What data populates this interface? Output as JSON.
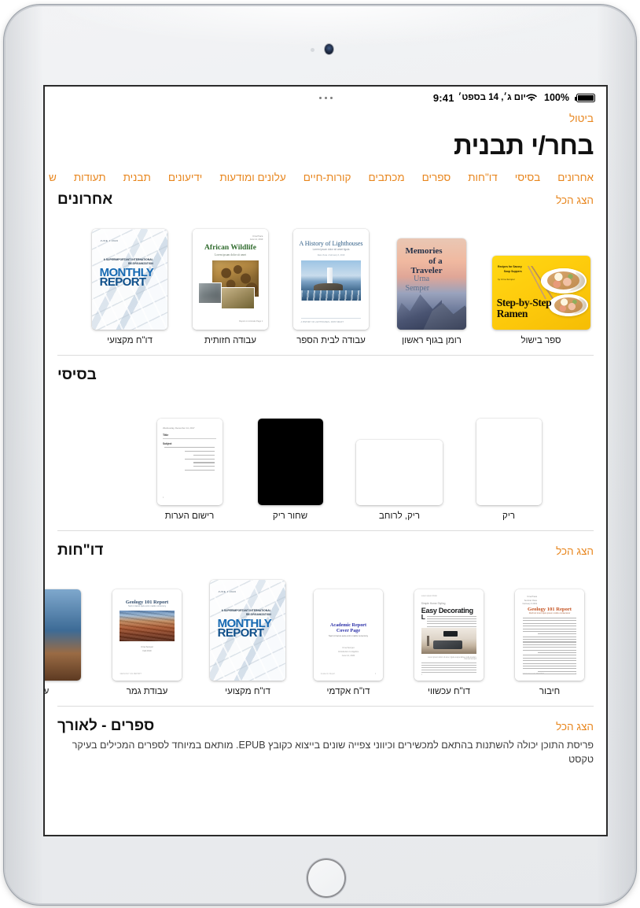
{
  "statusbar": {
    "time": "9:41",
    "date": "יום ג׳, 14 בספט׳",
    "battery_pct": "100%",
    "battery_icon": "battery-full-icon",
    "wifi_icon": "wifi-icon",
    "multitask_icon": "multitasking-dots-icon"
  },
  "topbar": {
    "cancel_label": "ביטול",
    "title": "בחר/י תבנית"
  },
  "tabs": [
    {
      "label": "אחרונים"
    },
    {
      "label": "בסיסי"
    },
    {
      "label": "דו\"חות"
    },
    {
      "label": "ספרים"
    },
    {
      "label": "מכתבים"
    },
    {
      "label": "קורות-חיים"
    },
    {
      "label": "עלונים ומודעות"
    },
    {
      "label": "ידיעונים"
    },
    {
      "label": "תבנית"
    },
    {
      "label": "תעודות"
    },
    {
      "label": "ש"
    }
  ],
  "sections": {
    "recents": {
      "title": "אחרונים",
      "show_all": "הצג הכל",
      "items": [
        {
          "label": "ספר בישול",
          "art": "ramen",
          "text": {
            "top": "Recipes for Savory\nSoup Suppers",
            "by": "by Urna Semper",
            "t1": "Step-by-Step",
            "t2": "Ramen"
          }
        },
        {
          "label": "רומן בגוף ראשון",
          "art": "memories",
          "text": {
            "title": "Memories\nof a\nTraveler",
            "author": "Urna\nSemper"
          }
        },
        {
          "label": "עבודה לבית הספר",
          "art": "lighthouse",
          "text": {
            "title": "A History of Lighthouses",
            "sub": "Lorem ipsum dolor sit amet ligula",
            "sub2": "Date Vivas  •  February 6, 2019",
            "foot": "A HISTORY OF LIGHTHOUSES  •  FIRST DRAFT"
          }
        },
        {
          "label": "עבודה חזותית",
          "art": "wildlife",
          "text": {
            "meta": "Urna Praca\nJune 14, 2019",
            "title": "African Wildlife",
            "sub": "Lorem ipsum dolor sit amet",
            "foot": "Report on Animals Page 1"
          }
        },
        {
          "label": "דו\"ח מקצועי",
          "art": "monthly",
          "text": {
            "date": "JUNE 1 2020",
            "sub": "A SUPERIMPORTANT INTERNATIONAL\nRE-ORGANIZATION",
            "t1": "MONTHLY",
            "t2": "REPORT"
          }
        }
      ]
    },
    "basic": {
      "title": "בסיסי",
      "items": [
        {
          "label": "ריק",
          "art": "blank-portrait"
        },
        {
          "label": "ריק, לרוחב",
          "art": "blank-landscape"
        },
        {
          "label": "שחור ריק",
          "art": "black-portrait"
        },
        {
          "label": "רישום הערות",
          "art": "note-taking",
          "text": {
            "head": "Wednesday, December 14, 2017",
            "title": "Title",
            "sub": "Subject",
            "page": "1"
          }
        }
      ]
    },
    "reports": {
      "title": "דו\"חות",
      "show_all": "הצג הכל",
      "items": [
        {
          "label": "חיבור",
          "art": "essay",
          "text": {
            "meta": "Urna Praca\nSeminar Class\nFebruary 6 2019",
            "title": "Geology 101 Report",
            "sub": "Draft sit lorem quis ipsum mollis consectetur",
            "foot": "GEOLOGY 101 REPORT",
            "page": "1"
          }
        },
        {
          "label": "דו\"ח עכשווי",
          "art": "decorating",
          "text": {
            "top": "Lorem ipsum Dolor",
            "kick": "Simple Home Styling",
            "title": "Easy Decorating",
            "drop": "L",
            "cap": "Lorem ipsum dolor sit amet, ligula suspendisse nulla pretium, rhoncus tempor.",
            "page": "1"
          }
        },
        {
          "label": "דו\"ח אקדמי",
          "art": "academic",
          "text": {
            "t1": "Academic Report",
            "t2": "Cover Page",
            "sub": "Sed mi lacus quis enim mattis nonummy",
            "meta": "Urna Semper\nIntroduction to Algebra\nJune 14, 2020",
            "foot": "Academic Report",
            "page": "1"
          }
        },
        {
          "label": "דו\"ח מקצועי",
          "art": "monthly",
          "text": {
            "date": "JUNE 1 2020",
            "sub": "A SUPERIMPORTANT INTERNATIONAL\nRE-ORGANIZATION",
            "t1": "MONTHLY",
            "t2": "REPORT"
          }
        },
        {
          "label": "עבודת גמר",
          "art": "thesis",
          "text": {
            "title": "Geology 101 Report",
            "sub": "Sed mi lacus quis enim mattis nonummy",
            "cap": "Urna Semper\nFall 2019",
            "foot": "GEOLOGY 101 REPORT"
          }
        },
        {
          "label": "ע",
          "art": "edge-photo"
        }
      ]
    },
    "books": {
      "title": "ספרים - לאורך",
      "show_all": "הצג הכל",
      "description": "פריסת התוכן יכולה להשתנות בהתאם למכשירים וכיווני צפייה שונים בייצוא כקובץ EPUB. מותאם במיוחד לספרים המכילים בעיקר טקסט"
    }
  },
  "colors": {
    "accent": "#E8861E",
    "text": "#111111",
    "screen_bg": "#ffffff"
  }
}
